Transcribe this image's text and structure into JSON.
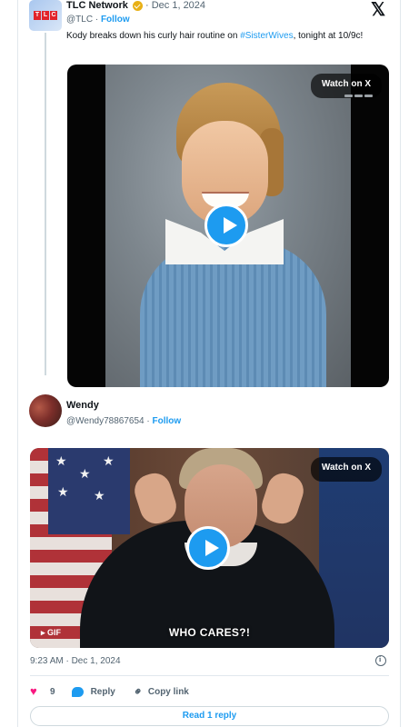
{
  "quoted_tweet": {
    "author_name": "TLC Network",
    "date": "· Dec 1, 2024",
    "handle": "@TLC",
    "separator": "·",
    "follow_label": "Follow",
    "text_before": "Kody breaks down his curly hair routine on ",
    "hashtag": "#SisterWives",
    "text_after": ", tonight at 10/9c!",
    "avatar_logo_letters": [
      "T",
      "L",
      "C"
    ],
    "media": {
      "watch_label": "Watch on X"
    }
  },
  "reply_tweet": {
    "author_name": "Wendy",
    "handle": "@Wendy78867654",
    "separator": "·",
    "follow_label": "Follow",
    "media": {
      "watch_label": "Watch on X",
      "gif_label": "GIF",
      "caption": "WHO CARES?!"
    },
    "timestamp": "9:23 AM · Dec 1, 2024",
    "likes": "9",
    "reply_label": "Reply",
    "copy_link_label": "Copy link",
    "read_replies_label": "Read 1 reply"
  },
  "colors": {
    "accent": "#1d9bf0",
    "like": "#f91880",
    "verified_badge": "#e8b016"
  },
  "icons": [
    "x-logo-icon",
    "verified-badge-icon",
    "play-icon",
    "heart-icon",
    "reply-icon",
    "link-icon",
    "info-icon"
  ]
}
